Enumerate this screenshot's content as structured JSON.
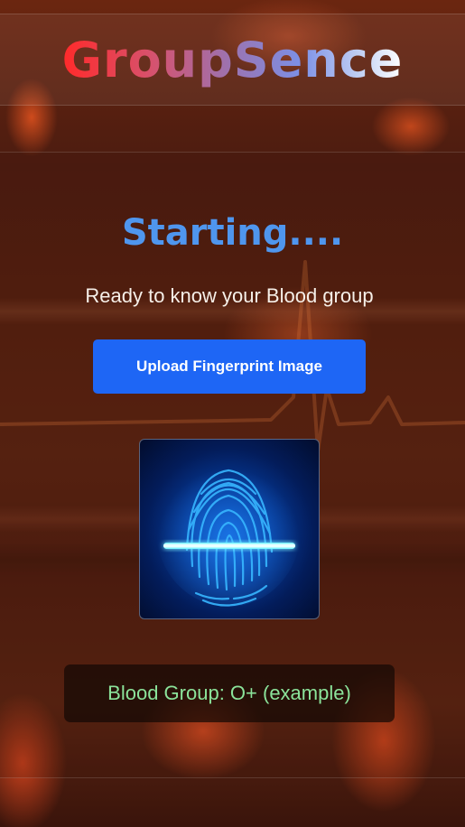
{
  "header": {
    "brand": "GroupSence"
  },
  "main": {
    "headline": "Starting....",
    "subtitle": "Ready to know your Blood group",
    "upload_button_label": "Upload Fingerprint Image",
    "result_text": "Blood Group: O+ (example)"
  },
  "icons": {
    "fingerprint": "fingerprint-scan-icon"
  },
  "colors": {
    "headline": "#4f96ee",
    "button": "#1e66f5",
    "result_text": "#8be39a",
    "brand_start": "#ff2a2a",
    "brand_end": "#ffffff"
  }
}
